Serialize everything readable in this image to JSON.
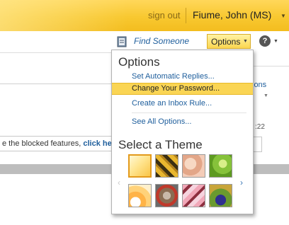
{
  "header": {
    "sign_out": "sign out",
    "user_name": "Fiume, John (MS)"
  },
  "toolbar": {
    "find_someone": "Find Someone",
    "options_label": "Options",
    "help_label": "?"
  },
  "background": {
    "info_text": "e the blocked features, ",
    "info_link": "click he",
    "right_link": "ions",
    "right_time": ":22"
  },
  "options_menu": {
    "title": "Options",
    "items": [
      {
        "label": "Set Automatic Replies..."
      },
      {
        "label": "Change Your Password...",
        "highlighted": true
      },
      {
        "label": "Create an Inbox Rule..."
      },
      {
        "label": "See All Options..."
      }
    ],
    "theme_title": "Select a Theme",
    "themes": [
      {
        "icon": "theme-sunrise",
        "selected": true
      },
      {
        "icon": "theme-stripes"
      },
      {
        "icon": "theme-peach"
      },
      {
        "icon": "theme-leaf"
      },
      {
        "icon": "theme-orange-bloom"
      },
      {
        "icon": "theme-robot"
      },
      {
        "icon": "theme-pink-pattern"
      },
      {
        "icon": "theme-monster"
      }
    ]
  },
  "colors": {
    "accent": "#f8c830",
    "highlight": "#fad554",
    "link": "#1e5e9c"
  }
}
